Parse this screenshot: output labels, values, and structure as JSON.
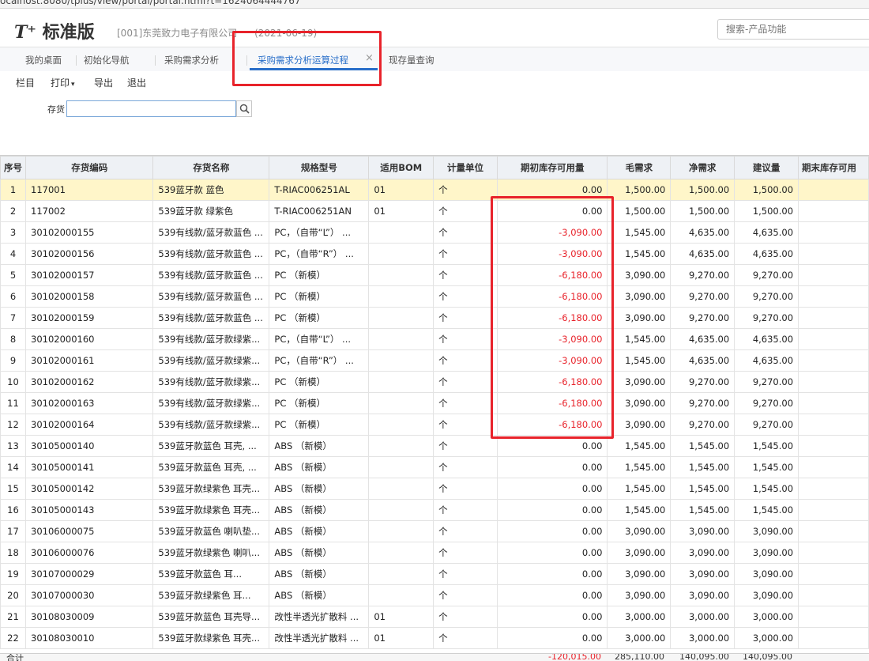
{
  "browser": {
    "url": "ocalhost:8080/tplus/view/portal/portal.html?t=1624064444767"
  },
  "header": {
    "logo_mark": "T⁺",
    "logo_text": "标准版",
    "company": "[001]东莞致力电子有限公司",
    "date": "(2021-06-19)",
    "search_placeholder": "搜索-产品功能"
  },
  "tabs": [
    {
      "label": "我的桌面"
    },
    {
      "label": "初始化导航"
    },
    {
      "label": "采购需求分析"
    },
    {
      "label": "采购需求分析运算过程",
      "active": true
    },
    {
      "label": "现存量查询"
    }
  ],
  "toolbar": {
    "columns": "栏目",
    "print": "打印",
    "export": "导出",
    "exit": "退出"
  },
  "filter": {
    "label": "存货",
    "value": ""
  },
  "table": {
    "headers": [
      "序号",
      "存货编码",
      "存货名称",
      "规格型号",
      "适用BOM",
      "计量单位",
      "期初库存可用量",
      "毛需求",
      "净需求",
      "建议量",
      "期末库存可用"
    ],
    "rows": [
      [
        "1",
        "117001",
        "539蓝牙款 蓝色",
        "T-RIAC006251AL",
        "01",
        "个",
        "0.00",
        "1,500.00",
        "1,500.00",
        "1,500.00"
      ],
      [
        "2",
        "117002",
        "539蓝牙款 绿紫色",
        "T-RIAC006251AN",
        "01",
        "个",
        "0.00",
        "1,500.00",
        "1,500.00",
        "1,500.00"
      ],
      [
        "3",
        "30102000155",
        "539有线款/蓝牙款蓝色 ...",
        "PC，（自带“L”） ...",
        "",
        "个",
        "-3,090.00",
        "1,545.00",
        "4,635.00",
        "4,635.00"
      ],
      [
        "4",
        "30102000156",
        "539有线款/蓝牙款蓝色 ...",
        "PC，（自带“R”） ...",
        "",
        "个",
        "-3,090.00",
        "1,545.00",
        "4,635.00",
        "4,635.00"
      ],
      [
        "5",
        "30102000157",
        "539有线款/蓝牙款蓝色 ...",
        "PC （新模）",
        "",
        "个",
        "-6,180.00",
        "3,090.00",
        "9,270.00",
        "9,270.00"
      ],
      [
        "6",
        "30102000158",
        "539有线款/蓝牙款蓝色 ...",
        "PC （新模）",
        "",
        "个",
        "-6,180.00",
        "3,090.00",
        "9,270.00",
        "9,270.00"
      ],
      [
        "7",
        "30102000159",
        "539有线款/蓝牙款蓝色 ...",
        "PC （新模）",
        "",
        "个",
        "-6,180.00",
        "3,090.00",
        "9,270.00",
        "9,270.00"
      ],
      [
        "8",
        "30102000160",
        "539有线款/蓝牙款绿紫...",
        "PC，（自带“L”） ...",
        "",
        "个",
        "-3,090.00",
        "1,545.00",
        "4,635.00",
        "4,635.00"
      ],
      [
        "9",
        "30102000161",
        "539有线款/蓝牙款绿紫...",
        "PC，（自带“R”） ...",
        "",
        "个",
        "-3,090.00",
        "1,545.00",
        "4,635.00",
        "4,635.00"
      ],
      [
        "10",
        "30102000162",
        "539有线款/蓝牙款绿紫...",
        "PC （新模）",
        "",
        "个",
        "-6,180.00",
        "3,090.00",
        "9,270.00",
        "9,270.00"
      ],
      [
        "11",
        "30102000163",
        "539有线款/蓝牙款绿紫...",
        "PC （新模）",
        "",
        "个",
        "-6,180.00",
        "3,090.00",
        "9,270.00",
        "9,270.00"
      ],
      [
        "12",
        "30102000164",
        "539有线款/蓝牙款绿紫...",
        "PC （新模）",
        "",
        "个",
        "-6,180.00",
        "3,090.00",
        "9,270.00",
        "9,270.00"
      ],
      [
        "13",
        "30105000140",
        "539蓝牙款蓝色 耳壳, ...",
        "ABS （新模）",
        "",
        "个",
        "0.00",
        "1,545.00",
        "1,545.00",
        "1,545.00"
      ],
      [
        "14",
        "30105000141",
        "539蓝牙款蓝色 耳壳, ...",
        "ABS （新模）",
        "",
        "个",
        "0.00",
        "1,545.00",
        "1,545.00",
        "1,545.00"
      ],
      [
        "15",
        "30105000142",
        "539蓝牙款绿紫色 耳壳...",
        "ABS （新模）",
        "",
        "个",
        "0.00",
        "1,545.00",
        "1,545.00",
        "1,545.00"
      ],
      [
        "16",
        "30105000143",
        "539蓝牙款绿紫色 耳壳...",
        "ABS （新模）",
        "",
        "个",
        "0.00",
        "1,545.00",
        "1,545.00",
        "1,545.00"
      ],
      [
        "17",
        "30106000075",
        "539蓝牙款蓝色 喇叭垫...",
        "ABS （新模）",
        "",
        "个",
        "0.00",
        "3,090.00",
        "3,090.00",
        "3,090.00"
      ],
      [
        "18",
        "30106000076",
        "539蓝牙款绿紫色 喇叭...",
        "ABS （新模）",
        "",
        "个",
        "0.00",
        "3,090.00",
        "3,090.00",
        "3,090.00"
      ],
      [
        "19",
        "30107000029",
        "539蓝牙款蓝色 耳...",
        "ABS （新模）",
        "",
        "个",
        "0.00",
        "3,090.00",
        "3,090.00",
        "3,090.00"
      ],
      [
        "20",
        "30107000030",
        "539蓝牙款绿紫色 耳...",
        "ABS （新模）",
        "",
        "个",
        "0.00",
        "3,090.00",
        "3,090.00",
        "3,090.00"
      ],
      [
        "21",
        "30108030009",
        "539蓝牙款蓝色 耳壳导...",
        "改性半透光扩散料 ...",
        "01",
        "个",
        "0.00",
        "3,000.00",
        "3,000.00",
        "3,000.00"
      ],
      [
        "22",
        "30108030010",
        "539蓝牙款绿紫色 耳壳...",
        "改性半透光扩散料 ...",
        "01",
        "个",
        "0.00",
        "3,000.00",
        "3,000.00",
        "3,000.00"
      ]
    ],
    "totals": {
      "label": "合计",
      "opening": "-120,015.00",
      "gross": "285,110.00",
      "net": "140,095.00",
      "suggested": "140,095.00"
    }
  },
  "colors": {
    "accent": "#2a6fc9",
    "negative": "#e8232b",
    "selected_row": "#fff6c9",
    "annotation": "#e8232b"
  }
}
